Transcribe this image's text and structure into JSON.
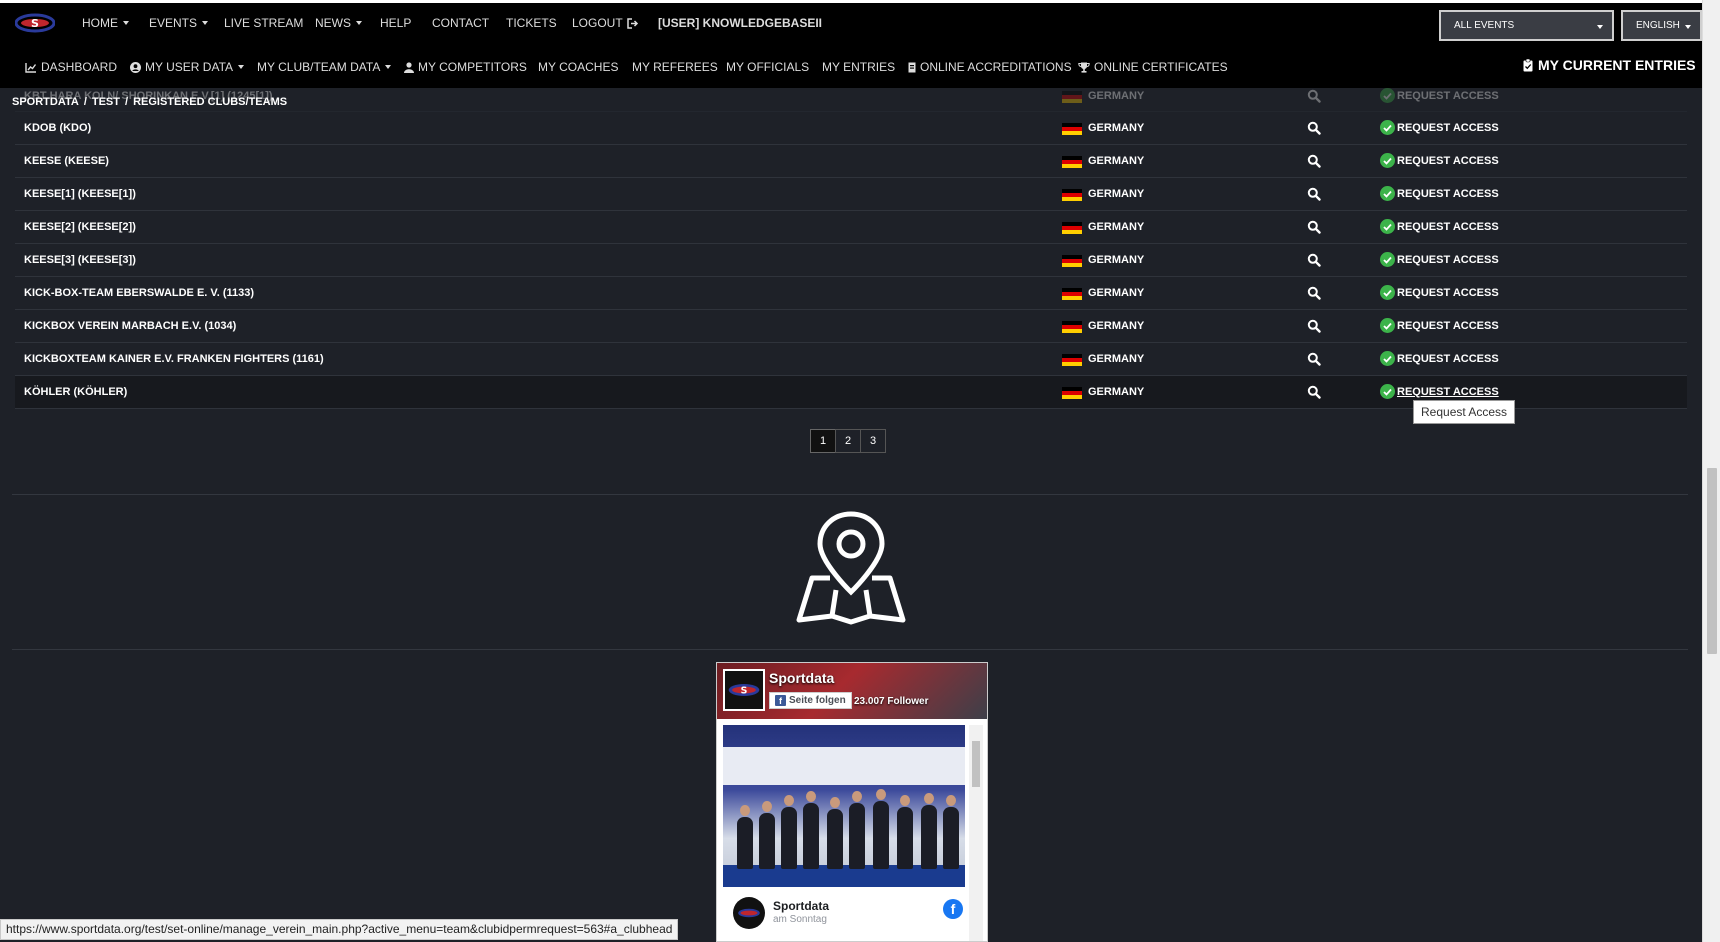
{
  "nav": {
    "home": "HOME",
    "events": "EVENTS",
    "live_stream": "LIVE STREAM",
    "news": "NEWS",
    "help": "HELP",
    "contact": "CONTACT",
    "tickets": "TICKETS",
    "logout": "LOGOUT",
    "user": "[USER] KNOWLEDGEBASEII",
    "events_select": "ALL EVENTS",
    "language_select": "ENGLISH"
  },
  "subnav": {
    "dashboard": "DASHBOARD",
    "my_user_data": "MY USER DATA",
    "my_club_team_data": "MY CLUB/TEAM DATA",
    "my_competitors": "MY COMPETITORS",
    "my_coaches": "MY COACHES",
    "my_referees": "MY REFEREES",
    "my_officials": "MY OFFICIALS",
    "my_entries": "MY ENTRIES",
    "online_accreditations": "ONLINE ACCREDITATIONS",
    "online_certificates": "ONLINE CERTIFICATES",
    "my_current_entries": "MY CURRENT ENTRIES"
  },
  "breadcrumb": {
    "items": [
      "SPORTDATA",
      "TEST",
      "REGISTERED CLUBS/TEAMS"
    ],
    "separator": "/"
  },
  "table": {
    "request_label": "REQUEST ACCESS",
    "rows": [
      {
        "club": "KBT HARA KOLN/ SHORINKAN E.V.[1] (1245[1])",
        "country": "GERMANY"
      },
      {
        "club": "KDOB (KDO)",
        "country": "GERMANY"
      },
      {
        "club": "KEESE (KEESE)",
        "country": "GERMANY"
      },
      {
        "club": "KEESE[1] (KEESE[1])",
        "country": "GERMANY"
      },
      {
        "club": "KEESE[2] (KEESE[2])",
        "country": "GERMANY"
      },
      {
        "club": "KEESE[3] (KEESE[3])",
        "country": "GERMANY"
      },
      {
        "club": "KICK-BOX-TEAM EBERSWALDE E. V. (1133)",
        "country": "GERMANY"
      },
      {
        "club": "KICKBOX VEREIN MARBACH E.V. (1034)",
        "country": "GERMANY"
      },
      {
        "club": "KICKBOXTEAM KAINER E.V. FRANKEN FIGHTERS (1161)",
        "country": "GERMANY"
      },
      {
        "club": "KÖHLER (KÖHLER)",
        "country": "GERMANY"
      }
    ]
  },
  "tooltip": "Request Access",
  "pagination": {
    "pages": [
      "1",
      "2",
      "3"
    ],
    "current": "1"
  },
  "facebook": {
    "page_name": "Sportdata",
    "follow_label": "Seite folgen",
    "followers": "23.007 Follower",
    "post_author": "Sportdata",
    "post_time": "am Sonntag"
  },
  "status_url": "https://www.sportdata.org/test/set-online/manage_verein_main.php?active_menu=team&clubidpermrequest=563#a_clubhead",
  "colors": {
    "background": "#1e2128",
    "navbar": "#000000",
    "check_green": "#3cb34a",
    "facebook_blue": "#1877f2"
  }
}
